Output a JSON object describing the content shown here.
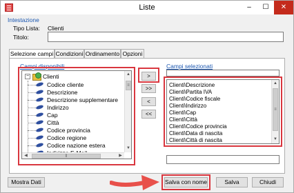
{
  "window": {
    "title": "Liste",
    "minimize": "–",
    "maximize": "☐",
    "close": "✕"
  },
  "header": {
    "section_title": "Intestazione",
    "tipo_lista_label": "Tipo Lista:",
    "tipo_lista_value": "Clienti",
    "titolo_label": "Titolo:",
    "titolo_value": ""
  },
  "tabs": [
    {
      "label": "Selezione campi",
      "active": true
    },
    {
      "label": "Condizioni",
      "active": false
    },
    {
      "label": "Ordinamento",
      "active": false
    },
    {
      "label": "Opzioni",
      "active": false
    }
  ],
  "available": {
    "label": "Campi disponibili",
    "root": "Clienti",
    "items": [
      "Codice cliente",
      "Descrizione",
      "Descrizione supplementare",
      "Indirizzo",
      "Cap",
      "Città",
      "Codice provincia",
      "Codice regione",
      "Codice nazione estera",
      "Indirizzo E-Mail"
    ]
  },
  "transfer_buttons": {
    "add": ">",
    "add_all": ">>",
    "remove": "<",
    "remove_all": "<<"
  },
  "selected": {
    "label": "Campi selezionati",
    "items": [
      "Clienti\\Descrizione",
      "Clienti\\Partita IVA",
      "Clienti\\Codice fiscale",
      "Clienti\\Indirizzo",
      "Clienti\\Cap",
      "Clienti\\Città",
      "Clienti\\Codice provincia",
      "Clienti\\Data di nascita",
      "Clienti\\Città di nascita"
    ]
  },
  "footer": {
    "show_data": "Mostra Dati",
    "save_as": "Salva con nome",
    "save": "Salva",
    "close": "Chiudi"
  },
  "colors": {
    "highlight": "#d9363e",
    "accent_text": "#1a56b0",
    "arrow": "#e8504a"
  },
  "icons": {
    "app": "list-app-icon",
    "root": "folder-globe-icon",
    "field": "field-icon"
  }
}
